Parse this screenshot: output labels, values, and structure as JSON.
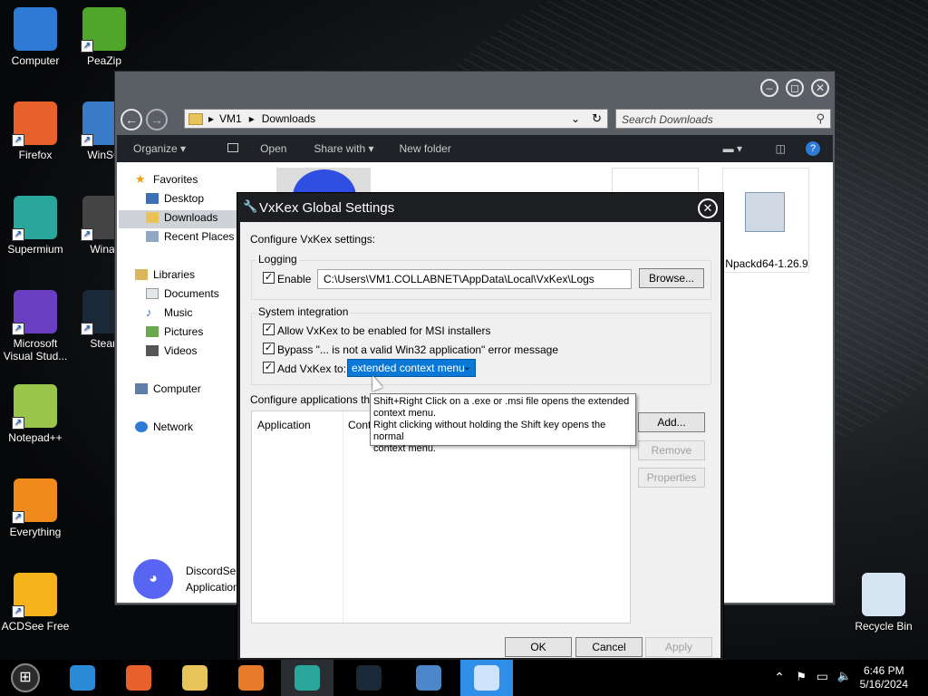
{
  "desktop": {
    "icons": [
      {
        "label": "Computer",
        "color": "#2e7bd6"
      },
      {
        "label": "PeaZip",
        "color": "#4fa62a"
      },
      {
        "label": "Firefox",
        "color": "#e8612c"
      },
      {
        "label": "WinSC",
        "color": "#3a7bc8"
      },
      {
        "label": "Supermium",
        "color": "#2aa79b"
      },
      {
        "label": "Winar",
        "color": "#444"
      },
      {
        "label": "Microsoft Visual Stud...",
        "color": "#6a3fc1"
      },
      {
        "label": "Stean",
        "color": "#1b2838"
      },
      {
        "label": "Notepad++",
        "color": "#9ac54b"
      },
      {
        "label": "Everything",
        "color": "#f08a1a"
      },
      {
        "label": "ACDSee Free",
        "color": "#f5b21a"
      },
      {
        "label": "Recycle Bin",
        "color": "#d5e4f0"
      }
    ],
    "shortcut_arrow": "↗"
  },
  "explorer": {
    "title_buttons": {
      "minimize": "–",
      "maximize": "◻",
      "close": "✕"
    },
    "nav": {
      "back": "←",
      "forward": "→"
    },
    "breadcrumb": [
      "VM1",
      "Downloads"
    ],
    "breadcrumb_sep": "▸",
    "search_placeholder": "Search Downloads",
    "toolbar": {
      "organize": "Organize ▾",
      "open": "Open",
      "share_with": "Share with ▾",
      "new_folder": "New folder"
    },
    "nav_pane": {
      "favorites": "Favorites",
      "desktop": "Desktop",
      "downloads": "Downloads",
      "recent_places": "Recent Places",
      "libraries": "Libraries",
      "documents": "Documents",
      "music": "Music",
      "pictures": "Pictures",
      "videos": "Videos",
      "computer": "Computer",
      "network": "Network"
    },
    "files": {
      "npackd_label": "Npackd64-1.26.9",
      "discord_name": "DiscordSe",
      "discord_type": "Application"
    }
  },
  "dialog": {
    "title": "VxKex Global Settings",
    "close": "✕",
    "configure_label": "Configure VxKex settings:",
    "logging": {
      "group_label": "Logging",
      "enable_label": "Enable",
      "enable_checked": "✓",
      "path_value": "C:\\Users\\VM1.COLLABNET\\AppData\\Local\\VxKex\\Logs",
      "browse_label": "Browse..."
    },
    "system_integration": {
      "group_label": "System integration",
      "allow_msi_label": "Allow VxKex to be enabled for MSI installers",
      "bypass_label": "Bypass \"... is not a valid Win32 application\" error message",
      "add_to_label": "Add VxKex to:",
      "check": "✓",
      "add_to_value": "extended context menu",
      "dropdown_chevron": "⌄"
    },
    "apps": {
      "label": "Configure applications that",
      "col_application": "Application",
      "col_contr": "Contr",
      "add_button": "Add...",
      "remove_button": "Remove",
      "properties_button": "Properties"
    },
    "tooltip": {
      "line1": "Shift+Right Click on a .exe or .msi file opens the extended",
      "line2": "context menu.",
      "line3": "Right clicking without holding the Shift key opens the normal",
      "line4": "context menu."
    },
    "buttons": {
      "ok": "OK",
      "cancel": "Cancel",
      "apply": "Apply"
    }
  },
  "taskbar": {
    "start_glyph": "⊞",
    "apps": [
      {
        "name": "internet-explorer",
        "color": "#2a8bd8"
      },
      {
        "name": "firefox",
        "color": "#e8612c"
      },
      {
        "name": "file-explorer",
        "color": "#e8c35a"
      },
      {
        "name": "media-player",
        "color": "#e87a2c"
      },
      {
        "name": "supermium",
        "color": "#2aa79b"
      },
      {
        "name": "steam",
        "color": "#1b2838"
      },
      {
        "name": "control-panel",
        "color": "#4a86c8"
      },
      {
        "name": "vxkex",
        "color": "#2f8ee8"
      }
    ],
    "tray": {
      "up": "⌃",
      "flag": "⚑",
      "monitor": "▭",
      "volume": "🔈"
    },
    "time": "6:46 PM",
    "date": "5/16/2024"
  }
}
